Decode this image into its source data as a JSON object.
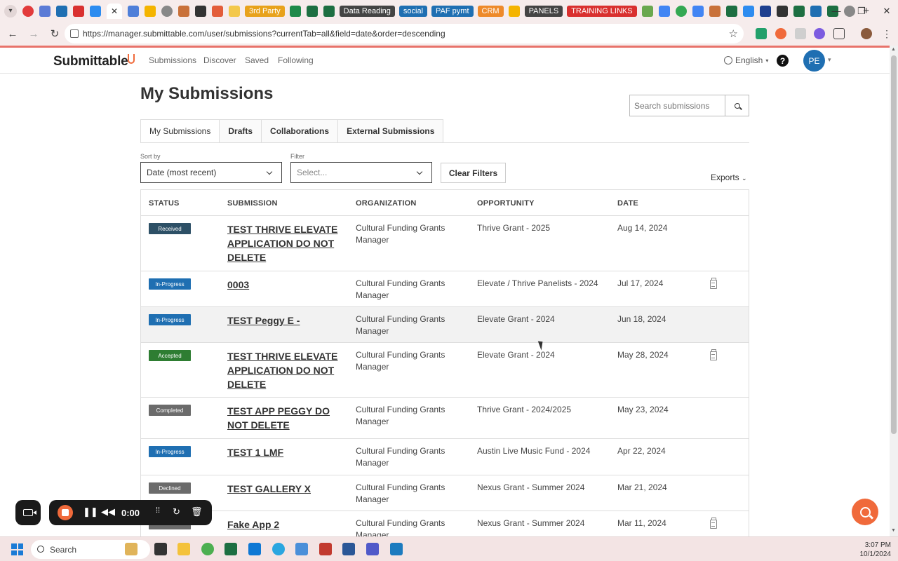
{
  "browser": {
    "bookmarks": [
      "3rd Party",
      "Data Reading",
      "social",
      "PAF pymt",
      "CRM",
      "PANELS",
      "TRAINING LINKS"
    ],
    "bookmark_colors": [
      "#e8a21c",
      "#444444",
      "#1f6fb2",
      "#1f6fb2",
      "#ee8a2a",
      "#444444",
      "#d9302f"
    ],
    "url": "https://manager.submittable.com/user/submissions?currentTab=all&field=date&order=descending"
  },
  "header": {
    "logo": "Submittable",
    "nav": [
      "Submissions",
      "Discover",
      "Saved",
      "Following"
    ],
    "language": "English",
    "help": "?",
    "avatar": "PE"
  },
  "main": {
    "title": "My Submissions",
    "search_placeholder": "Search submissions",
    "tabs": [
      "My Submissions",
      "Drafts",
      "Collaborations",
      "External Submissions"
    ],
    "sort_label": "Sort by",
    "sort_value": "Date (most recent)",
    "filter_label": "Filter",
    "filter_placeholder": "Select...",
    "clear_filters": "Clear Filters",
    "exports": "Exports"
  },
  "table": {
    "columns": [
      "STATUS",
      "SUBMISSION",
      "ORGANIZATION",
      "OPPORTUNITY",
      "DATE"
    ],
    "rows": [
      {
        "status": "Received",
        "status_color": "#2d5066",
        "submission": "TEST THRIVE ELEVATE APPLICATION DO NOT DELETE",
        "organization": "Cultural Funding Grants Manager",
        "opportunity": "Thrive Grant - 2025",
        "date": "Aug 14, 2024",
        "doc": false
      },
      {
        "status": "In-Progress",
        "status_color": "#1f6fb2",
        "submission": "0003",
        "organization": "Cultural Funding Grants Manager",
        "opportunity": "Elevate / Thrive Panelists - 2024",
        "date": "Jul 17, 2024",
        "doc": true
      },
      {
        "status": "In-Progress",
        "status_color": "#1f6fb2",
        "submission": "TEST Peggy E -",
        "organization": "Cultural Funding Grants Manager",
        "opportunity": "Elevate Grant - 2024",
        "date": "Jun 18, 2024",
        "doc": false
      },
      {
        "status": "Accepted",
        "status_color": "#2e7d32",
        "submission": "TEST THRIVE ELEVATE APPLICATION DO NOT DELETE",
        "organization": "Cultural Funding Grants Manager",
        "opportunity": "Elevate Grant - 2024",
        "date": "May 28, 2024",
        "doc": true
      },
      {
        "status": "Completed",
        "status_color": "#6b6b6b",
        "submission": "TEST APP PEGGY DO NOT DELETE",
        "organization": "Cultural Funding Grants Manager",
        "opportunity": "Thrive Grant - 2024/2025",
        "date": "May 23, 2024",
        "doc": false
      },
      {
        "status": "In-Progress",
        "status_color": "#1f6fb2",
        "submission": "TEST 1 LMF",
        "organization": "Cultural Funding Grants Manager",
        "opportunity": "Austin Live Music Fund - 2024",
        "date": "Apr 22, 2024",
        "doc": false
      },
      {
        "status": "Declined",
        "status_color": "#6b6b6b",
        "submission": "TEST GALLERY X",
        "organization": "Cultural Funding Grants Manager",
        "opportunity": "Nexus Grant - Summer 2024",
        "date": "Mar 21, 2024",
        "doc": false
      },
      {
        "status": "",
        "status_color": "#6b6b6b",
        "submission": "Fake App 2",
        "organization": "Cultural Funding Grants Manager",
        "opportunity": "Nexus Grant - Summer 2024",
        "date": "Mar 11, 2024",
        "doc": true
      }
    ]
  },
  "recorder": {
    "time": "0:00"
  },
  "taskbar": {
    "search": "Search",
    "time": "3:07 PM",
    "date": "10/1/2024"
  }
}
